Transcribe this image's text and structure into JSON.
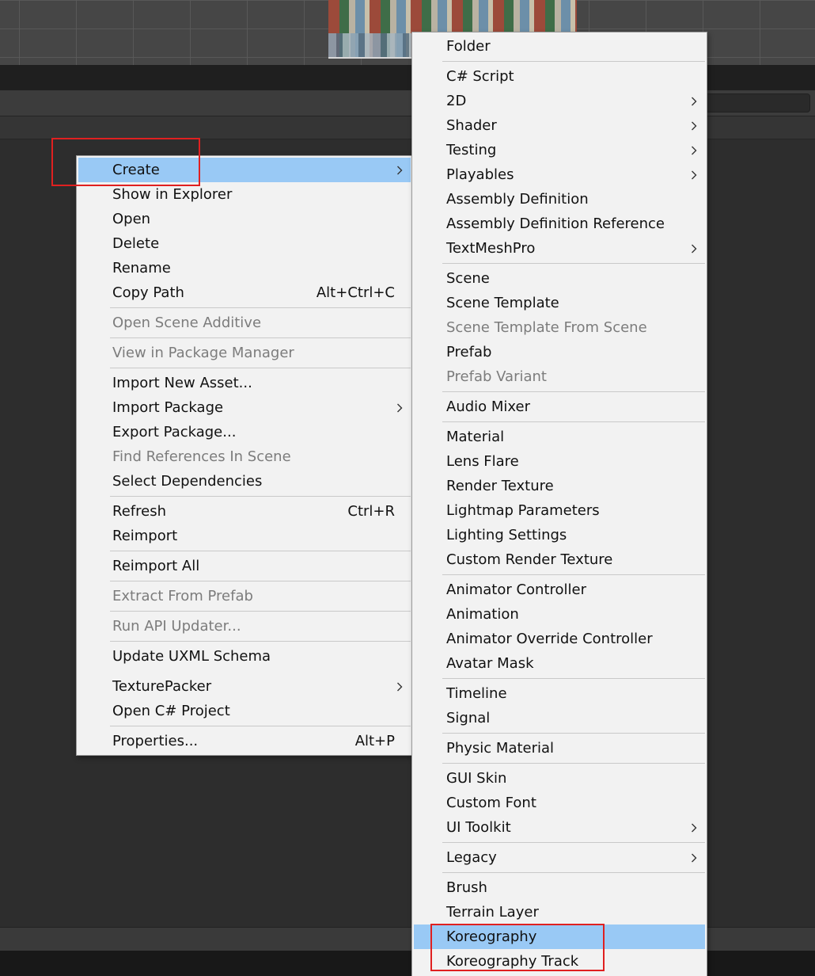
{
  "context_menu": {
    "items": [
      {
        "label": "Create",
        "shortcut": "",
        "has_submenu": true,
        "disabled": false,
        "highlighted": true
      },
      {
        "label": "Show in Explorer",
        "shortcut": "",
        "has_submenu": false,
        "disabled": false,
        "highlighted": false
      },
      {
        "label": "Open",
        "shortcut": "",
        "has_submenu": false,
        "disabled": false,
        "highlighted": false
      },
      {
        "label": "Delete",
        "shortcut": "",
        "has_submenu": false,
        "disabled": false,
        "highlighted": false
      },
      {
        "label": "Rename",
        "shortcut": "",
        "has_submenu": false,
        "disabled": false,
        "highlighted": false
      },
      {
        "label": "Copy Path",
        "shortcut": "Alt+Ctrl+C",
        "has_submenu": false,
        "disabled": false,
        "highlighted": false
      },
      {
        "label": "Open Scene Additive",
        "shortcut": "",
        "has_submenu": false,
        "disabled": true,
        "highlighted": false
      },
      {
        "label": "View in Package Manager",
        "shortcut": "",
        "has_submenu": false,
        "disabled": true,
        "highlighted": false
      },
      {
        "label": "Import New Asset...",
        "shortcut": "",
        "has_submenu": false,
        "disabled": false,
        "highlighted": false
      },
      {
        "label": "Import Package",
        "shortcut": "",
        "has_submenu": true,
        "disabled": false,
        "highlighted": false
      },
      {
        "label": "Export Package...",
        "shortcut": "",
        "has_submenu": false,
        "disabled": false,
        "highlighted": false
      },
      {
        "label": "Find References In Scene",
        "shortcut": "",
        "has_submenu": false,
        "disabled": true,
        "highlighted": false
      },
      {
        "label": "Select Dependencies",
        "shortcut": "",
        "has_submenu": false,
        "disabled": false,
        "highlighted": false
      },
      {
        "label": "Refresh",
        "shortcut": "Ctrl+R",
        "has_submenu": false,
        "disabled": false,
        "highlighted": false
      },
      {
        "label": "Reimport",
        "shortcut": "",
        "has_submenu": false,
        "disabled": false,
        "highlighted": false
      },
      {
        "label": "Reimport All",
        "shortcut": "",
        "has_submenu": false,
        "disabled": false,
        "highlighted": false
      },
      {
        "label": "Extract From Prefab",
        "shortcut": "",
        "has_submenu": false,
        "disabled": true,
        "highlighted": false
      },
      {
        "label": "Run API Updater...",
        "shortcut": "",
        "has_submenu": false,
        "disabled": true,
        "highlighted": false
      },
      {
        "label": "Update UXML Schema",
        "shortcut": "",
        "has_submenu": false,
        "disabled": false,
        "highlighted": false
      },
      {
        "label": "TexturePacker",
        "shortcut": "",
        "has_submenu": true,
        "disabled": false,
        "highlighted": false
      },
      {
        "label": "Open C# Project",
        "shortcut": "",
        "has_submenu": false,
        "disabled": false,
        "highlighted": false
      },
      {
        "label": "Properties...",
        "shortcut": "Alt+P",
        "has_submenu": false,
        "disabled": false,
        "highlighted": false
      }
    ]
  },
  "create_submenu": {
    "items": [
      {
        "label": "Folder",
        "has_submenu": false,
        "disabled": false,
        "highlighted": false
      },
      {
        "label": "C# Script",
        "has_submenu": false,
        "disabled": false,
        "highlighted": false
      },
      {
        "label": "2D",
        "has_submenu": true,
        "disabled": false,
        "highlighted": false
      },
      {
        "label": "Shader",
        "has_submenu": true,
        "disabled": false,
        "highlighted": false
      },
      {
        "label": "Testing",
        "has_submenu": true,
        "disabled": false,
        "highlighted": false
      },
      {
        "label": "Playables",
        "has_submenu": true,
        "disabled": false,
        "highlighted": false
      },
      {
        "label": "Assembly Definition",
        "has_submenu": false,
        "disabled": false,
        "highlighted": false
      },
      {
        "label": "Assembly Definition Reference",
        "has_submenu": false,
        "disabled": false,
        "highlighted": false
      },
      {
        "label": "TextMeshPro",
        "has_submenu": true,
        "disabled": false,
        "highlighted": false
      },
      {
        "label": "Scene",
        "has_submenu": false,
        "disabled": false,
        "highlighted": false
      },
      {
        "label": "Scene Template",
        "has_submenu": false,
        "disabled": false,
        "highlighted": false
      },
      {
        "label": "Scene Template From Scene",
        "has_submenu": false,
        "disabled": true,
        "highlighted": false
      },
      {
        "label": "Prefab",
        "has_submenu": false,
        "disabled": false,
        "highlighted": false
      },
      {
        "label": "Prefab Variant",
        "has_submenu": false,
        "disabled": true,
        "highlighted": false
      },
      {
        "label": "Audio Mixer",
        "has_submenu": false,
        "disabled": false,
        "highlighted": false
      },
      {
        "label": "Material",
        "has_submenu": false,
        "disabled": false,
        "highlighted": false
      },
      {
        "label": "Lens Flare",
        "has_submenu": false,
        "disabled": false,
        "highlighted": false
      },
      {
        "label": "Render Texture",
        "has_submenu": false,
        "disabled": false,
        "highlighted": false
      },
      {
        "label": "Lightmap Parameters",
        "has_submenu": false,
        "disabled": false,
        "highlighted": false
      },
      {
        "label": "Lighting Settings",
        "has_submenu": false,
        "disabled": false,
        "highlighted": false
      },
      {
        "label": "Custom Render Texture",
        "has_submenu": false,
        "disabled": false,
        "highlighted": false
      },
      {
        "label": "Animator Controller",
        "has_submenu": false,
        "disabled": false,
        "highlighted": false
      },
      {
        "label": "Animation",
        "has_submenu": false,
        "disabled": false,
        "highlighted": false
      },
      {
        "label": "Animator Override Controller",
        "has_submenu": false,
        "disabled": false,
        "highlighted": false
      },
      {
        "label": "Avatar Mask",
        "has_submenu": false,
        "disabled": false,
        "highlighted": false
      },
      {
        "label": "Timeline",
        "has_submenu": false,
        "disabled": false,
        "highlighted": false
      },
      {
        "label": "Signal",
        "has_submenu": false,
        "disabled": false,
        "highlighted": false
      },
      {
        "label": "Physic Material",
        "has_submenu": false,
        "disabled": false,
        "highlighted": false
      },
      {
        "label": "GUI Skin",
        "has_submenu": false,
        "disabled": false,
        "highlighted": false
      },
      {
        "label": "Custom Font",
        "has_submenu": false,
        "disabled": false,
        "highlighted": false
      },
      {
        "label": "UI Toolkit",
        "has_submenu": true,
        "disabled": false,
        "highlighted": false
      },
      {
        "label": "Legacy",
        "has_submenu": true,
        "disabled": false,
        "highlighted": false
      },
      {
        "label": "Brush",
        "has_submenu": false,
        "disabled": false,
        "highlighted": false
      },
      {
        "label": "Terrain Layer",
        "has_submenu": false,
        "disabled": false,
        "highlighted": false
      },
      {
        "label": "Koreography",
        "has_submenu": false,
        "disabled": false,
        "highlighted": true
      },
      {
        "label": "Koreography Track",
        "has_submenu": false,
        "disabled": false,
        "highlighted": false
      }
    ]
  },
  "colors": {
    "menu_background": "#f2f2f2",
    "highlight": "#99c9f5",
    "disabled_text": "#7c7c7c",
    "annotation_box": "#e02020"
  }
}
